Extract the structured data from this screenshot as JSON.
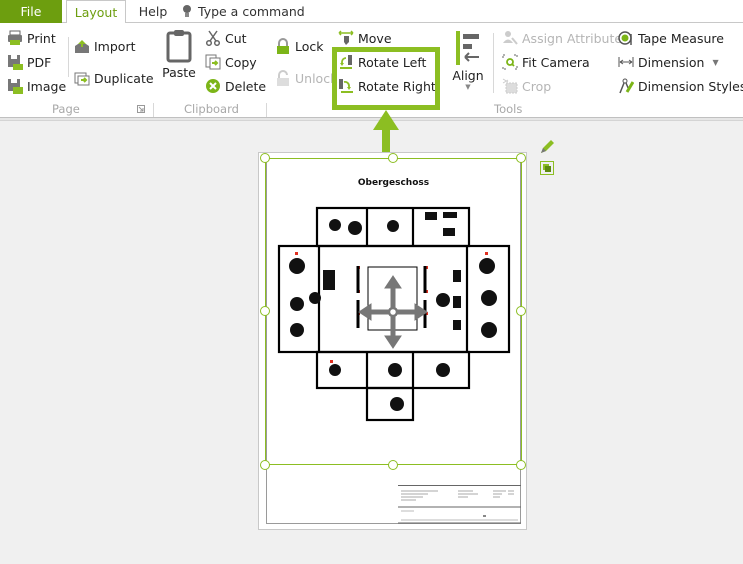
{
  "menu": {
    "tabs": [
      {
        "label": "File",
        "active": false
      },
      {
        "label": "Layout",
        "active": true
      },
      {
        "label": "Help",
        "active": false
      }
    ],
    "command_search": {
      "placeholder": "Type a command",
      "icon": "lightbulb-icon"
    }
  },
  "ribbon": {
    "groups": {
      "page": {
        "label": "Page",
        "items": [
          {
            "label": "Print",
            "icon": "printer-icon",
            "enabled": true
          },
          {
            "label": "PDF",
            "icon": "pdf-save-icon",
            "enabled": true
          },
          {
            "label": "Image",
            "icon": "image-save-icon",
            "enabled": true
          },
          {
            "label": "Import",
            "icon": "import-icon",
            "enabled": true
          },
          {
            "label": "Duplicate",
            "icon": "duplicate-icon",
            "enabled": true
          }
        ]
      },
      "clipboard": {
        "label": "Clipboard",
        "items": [
          {
            "label": "Paste",
            "icon": "clipboard-icon",
            "enabled": true
          },
          {
            "label": "Cut",
            "icon": "scissors-icon",
            "enabled": true
          },
          {
            "label": "Copy",
            "icon": "copy-icon",
            "enabled": true
          },
          {
            "label": "Delete",
            "icon": "delete-icon",
            "enabled": true
          }
        ]
      },
      "tools": {
        "label": "Tools",
        "items": [
          {
            "label": "Lock",
            "icon": "lock-icon",
            "enabled": true
          },
          {
            "label": "Unlock",
            "icon": "unlock-icon",
            "enabled": false
          },
          {
            "label": "Move",
            "icon": "move-icon",
            "enabled": true
          },
          {
            "label": "Rotate Left",
            "icon": "rotate-left-icon",
            "enabled": true
          },
          {
            "label": "Rotate Right",
            "icon": "rotate-right-icon",
            "enabled": true
          },
          {
            "label": "Align",
            "icon": "align-icon",
            "enabled": true
          },
          {
            "label": "Assign Attributes",
            "icon": "assign-attributes-icon",
            "enabled": false
          },
          {
            "label": "Fit Camera",
            "icon": "fit-camera-icon",
            "enabled": true
          },
          {
            "label": "Crop",
            "icon": "crop-icon",
            "enabled": false
          },
          {
            "label": "Tape Measure",
            "icon": "tape-measure-icon",
            "enabled": true
          },
          {
            "label": "Dimension",
            "icon": "dimension-icon",
            "enabled": true
          },
          {
            "label": "Dimension Styles",
            "icon": "dimension-styles-icon",
            "enabled": true
          }
        ]
      }
    }
  },
  "canvas": {
    "plan_title": "Obergeschoss",
    "accent_color": "#8cbe22",
    "brand_color": "#6d9e0f"
  }
}
